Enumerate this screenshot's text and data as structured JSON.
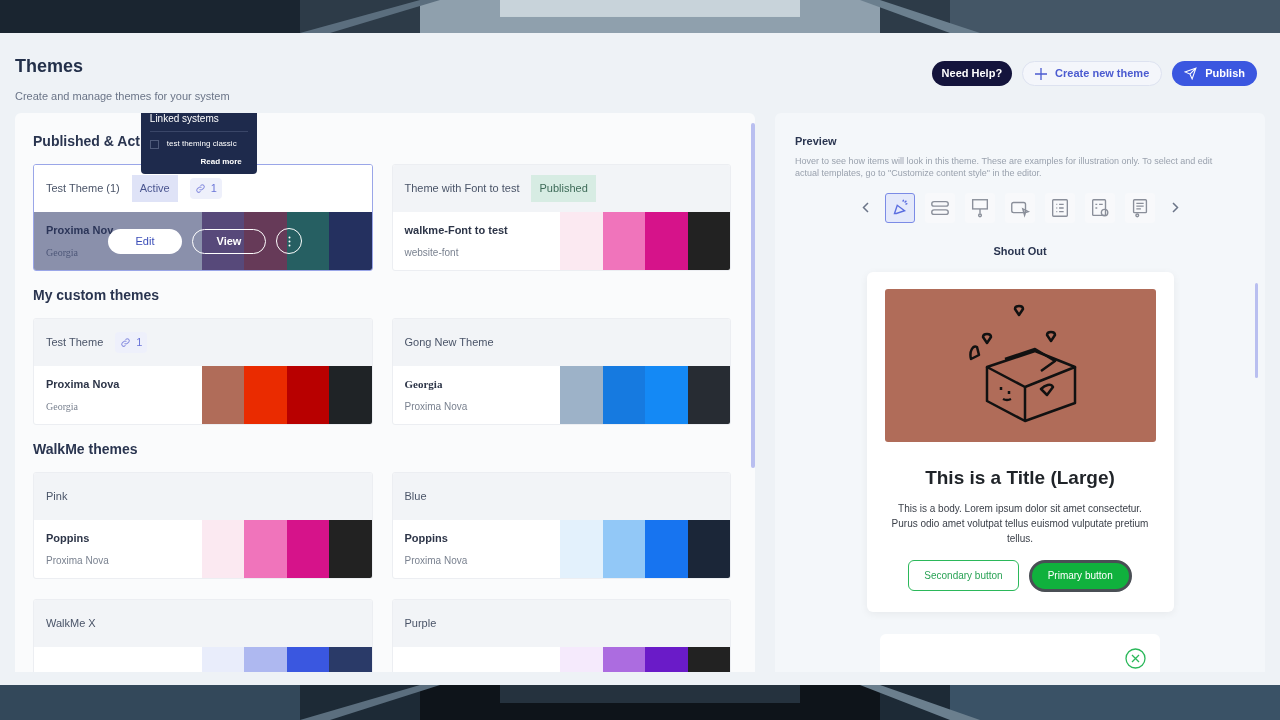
{
  "header": {
    "title": "Themes",
    "subtitle": "Create and manage themes for your system",
    "buttons": [
      {
        "kind": "help",
        "label": "Need Help?"
      },
      {
        "kind": "create",
        "label": "Create new theme"
      },
      {
        "kind": "publish",
        "label": "Publish"
      }
    ]
  },
  "sections": [
    {
      "title": "Published & Act",
      "themes": [
        {
          "name": "Test Theme (1)",
          "badge": {
            "kind": "active",
            "label": "Active"
          },
          "links": "1",
          "hovered": true,
          "primary_font": {
            "name": "Proxima Nov",
            "serif": false
          },
          "secondary_font": {
            "name": "Georgia",
            "serif": true
          },
          "swatches": [
            {
              "color": "#57497a"
            },
            {
              "color": "#663a58"
            },
            {
              "color": "#265f62"
            },
            {
              "color": "#24305f"
            }
          ],
          "actions": [
            "Edit",
            "View"
          ]
        },
        {
          "name": "Theme with Font to test",
          "badge": {
            "kind": "published",
            "label": "Published"
          },
          "hovered": false,
          "primary_font": {
            "name": "walkme-Font to test",
            "serif": false
          },
          "secondary_font": {
            "name": "website-font",
            "serif": false
          },
          "swatches": [
            {
              "color": "#fbe9f1"
            },
            {
              "color": "#f074bb"
            },
            {
              "color": "#d6138a"
            },
            {
              "color": "#222222"
            }
          ]
        }
      ]
    },
    {
      "title": "My custom themes",
      "themes": [
        {
          "name": "Test Theme",
          "links": "1",
          "hovered": false,
          "primary_font": {
            "name": "Proxima Nova",
            "serif": false
          },
          "secondary_font": {
            "name": "Georgia",
            "serif": true
          },
          "swatches": [
            {
              "color": "#b06c59"
            },
            {
              "color": "#ea2b00"
            },
            {
              "color": "#b80000"
            },
            {
              "color": "#1f2326"
            }
          ]
        },
        {
          "name": "Gong New Theme",
          "hovered": false,
          "primary_font": {
            "name": "Georgia",
            "serif": true
          },
          "secondary_font": {
            "name": "Proxima Nova",
            "serif": false
          },
          "swatches": [
            {
              "color": "#9db2c8"
            },
            {
              "color": "#167ae0"
            },
            {
              "color": "#1489f5"
            },
            {
              "color": "#272c33"
            }
          ]
        }
      ]
    },
    {
      "title": "WalkMe themes",
      "themes": [
        {
          "name": "Pink",
          "hovered": false,
          "primary_font": {
            "name": "Poppins",
            "serif": false
          },
          "secondary_font": {
            "name": "Proxima Nova",
            "serif": false
          },
          "swatches": [
            {
              "color": "#fbe9f1"
            },
            {
              "color": "#f074bb"
            },
            {
              "color": "#d6138a"
            },
            {
              "color": "#222222"
            }
          ]
        },
        {
          "name": "Blue",
          "hovered": false,
          "primary_font": {
            "name": "Poppins",
            "serif": false
          },
          "secondary_font": {
            "name": "Proxima Nova",
            "serif": false
          },
          "swatches": [
            {
              "color": "#e3f1fc"
            },
            {
              "color": "#92c8f7"
            },
            {
              "color": "#1774f0"
            },
            {
              "color": "#1b2638"
            }
          ]
        },
        {
          "name": "WalkMe X",
          "hovered": false,
          "swatches": [
            {
              "color": "#e9edfb"
            },
            {
              "color": "#aeb8f0"
            },
            {
              "color": "#3a57e0"
            },
            {
              "color": "#2a3a68"
            }
          ]
        },
        {
          "name": "Purple",
          "hovered": false,
          "swatches": [
            {
              "color": "#f5eafc"
            },
            {
              "color": "#ac6ce0"
            },
            {
              "color": "#6a1bc8"
            },
            {
              "color": "#222222"
            }
          ]
        }
      ]
    }
  ],
  "tooltip": {
    "title": "Linked systems",
    "items": [
      {
        "label": "test theming classic",
        "checked": false
      }
    ],
    "link": "Read more"
  },
  "preview": {
    "title": "Preview",
    "description": "Hover to see how items will look in this theme. These are examples for illustration only. To select and edit actual templates, go to \"Customize content style\" in the editor.",
    "templates": [
      {
        "kind": "shoutout",
        "selected": true
      },
      {
        "kind": "steps",
        "selected": false
      },
      {
        "kind": "launcher",
        "selected": false
      },
      {
        "kind": "smarttip",
        "selected": false
      },
      {
        "kind": "survey",
        "selected": false
      },
      {
        "kind": "checklist",
        "selected": false
      },
      {
        "kind": "form",
        "selected": false
      }
    ],
    "template_name": "Shout Out",
    "card_title": "This is a Title (Large)",
    "card_body": "This is a body. Lorem ipsum dolor sit amet consectetur. Purus odio amet volutpat tellus euismod vulputate pretium tellus.",
    "card_buttons": [
      {
        "kind": "secondary",
        "label": "Secondary button"
      },
      {
        "kind": "primary",
        "label": "Primary button"
      }
    ]
  }
}
